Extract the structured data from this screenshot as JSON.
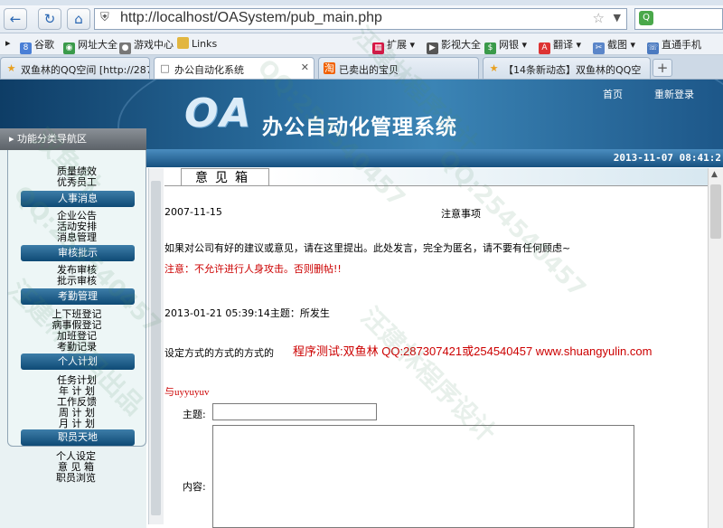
{
  "browser": {
    "address": "http://localhost/OASystem/pub_main.php",
    "bookmarks": [
      "谷歌",
      "网址大全",
      "游戏中心",
      "Links"
    ],
    "toolbar_right": [
      "扩展",
      "影视大全",
      "网银",
      "翻译",
      "截图",
      "直通手机"
    ],
    "tabs": [
      {
        "title": "双鱼林的QQ空间 [http://287"
      },
      {
        "title": "办公自动化系统"
      },
      {
        "title": "已卖出的宝贝"
      },
      {
        "title": "【14条新动态】双鱼林的QQ空"
      }
    ],
    "new_tab": "+"
  },
  "header": {
    "logo": "OA",
    "system_title": "办公自动化管理系统",
    "link_home": "首页",
    "link_relogin": "重新登录",
    "datetime": "2013-11-07 08:41:2"
  },
  "sidebar": {
    "title": "功能分类导航区",
    "groups": [
      {
        "label": "人事消息",
        "items_before": [
          "质量绩效",
          "优秀员工"
        ],
        "items": [
          "企业公告",
          "活动安排",
          "消息管理"
        ]
      },
      {
        "label": "审核批示",
        "items": [
          "发布审核",
          "批示审核"
        ]
      },
      {
        "label": "考勤管理",
        "items": [
          "上下班登记",
          "病事假登记",
          "加班登记",
          "考勤记录"
        ]
      },
      {
        "label": "个人计划",
        "items": [
          "任务计划",
          "年 计 划",
          "工作反馈",
          "周 计 划",
          "月 计 划"
        ]
      },
      {
        "label": "职员天地",
        "items": [
          "个人设定",
          "意 见 箱",
          "职员浏览"
        ]
      }
    ]
  },
  "content": {
    "tab_label": "意见箱",
    "date": "2007-11-15",
    "notice_title": "注意事项",
    "notice_text": "如果对公司有好的建议或意见，请在这里提出。此处发言，完全为匿名，请不要有任何顾虑~",
    "warning": "注意：不允许进行人身攻击。否则删帖!!",
    "post_meta": "2013-01-21 05:39:14主题：所发生",
    "post_body": "设定方式的方式的方式的",
    "promo": "程序测试:双鱼林 QQ:287307421或254540457 www.shuangyulin.com",
    "post_from": "与uyyuyuv",
    "subject_label": "主题:",
    "subject_value": "",
    "content_label": "内容:",
    "content_value": ""
  },
  "watermarks": [
    "汪建林程序设计",
    "QQ:254540457",
    "双鱼林",
    "汪建林源码出品",
    "QQ:254540457",
    "汪建林程序设计",
    "QQ:254540457"
  ]
}
